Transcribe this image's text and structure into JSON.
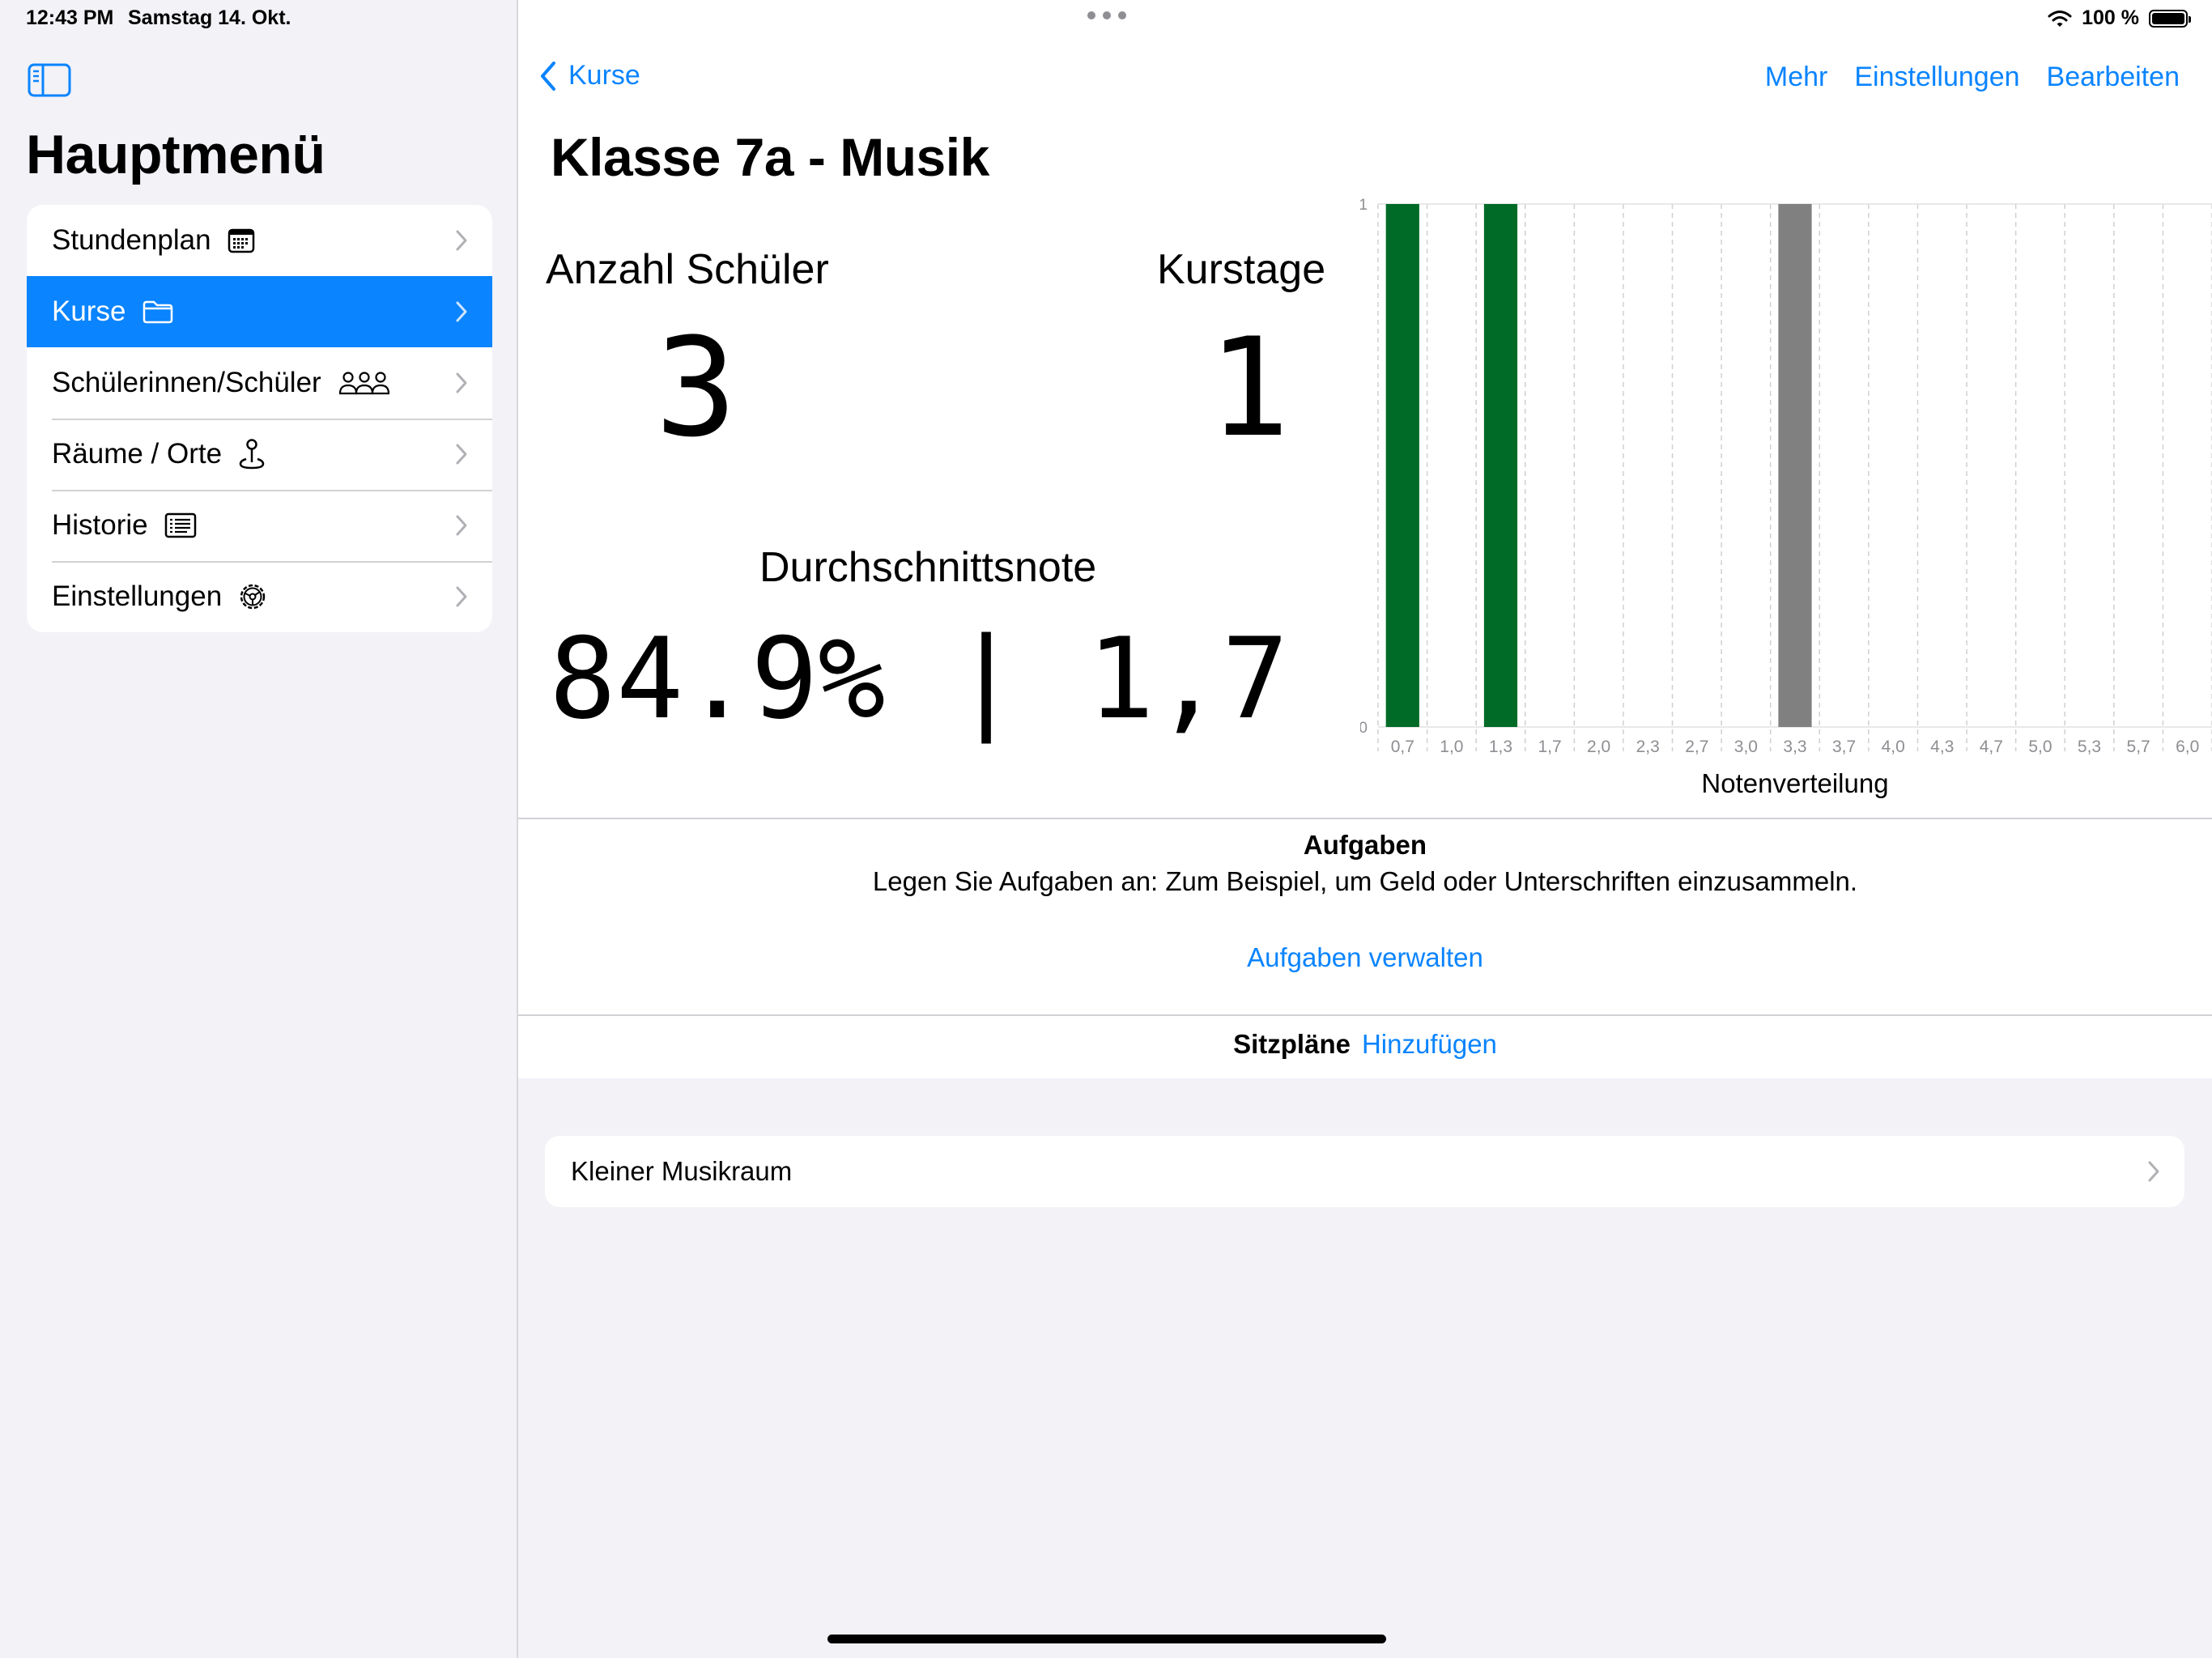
{
  "status": {
    "time": "12:43 PM",
    "date": "Samstag 14. Okt.",
    "battery": "100 %",
    "battery_level": 1.0
  },
  "sidebar": {
    "title": "Hauptmenü",
    "items": [
      {
        "label": "Stundenplan",
        "icon": "calendar-icon",
        "active": false
      },
      {
        "label": "Kurse",
        "icon": "folder-icon",
        "active": true
      },
      {
        "label": "Schülerinnen/Schüler",
        "icon": "people-icon",
        "active": false
      },
      {
        "label": "Räume / Orte",
        "icon": "map-pin-icon",
        "active": false
      },
      {
        "label": "Historie",
        "icon": "list-icon",
        "active": false
      },
      {
        "label": "Einstellungen",
        "icon": "gear-icon",
        "active": false
      }
    ]
  },
  "nav": {
    "back_label": "Kurse",
    "actions": [
      "Mehr",
      "Einstellungen",
      "Bearbeiten"
    ]
  },
  "course": {
    "title": "Klasse 7a - Musik",
    "students_label": "Anzahl Schüler",
    "students_value": "3",
    "days_label": "Kurstage",
    "days_value": "1",
    "average_label": "Durchschnittsnote",
    "average_percent": "84.9%",
    "average_separator": "|",
    "average_grade": "1,7"
  },
  "chart_data": {
    "type": "bar",
    "xlabel": "Notenverteilung",
    "ylabel": "",
    "ylim": [
      0,
      1
    ],
    "y_ticks": [
      "0",
      "1"
    ],
    "categories": [
      "0,7",
      "1,0",
      "1,3",
      "1,7",
      "2,0",
      "2,3",
      "2,7",
      "3,0",
      "3,3",
      "3,7",
      "4,0",
      "4,3",
      "4,7",
      "5,0",
      "5,3",
      "5,7",
      "6,0"
    ],
    "values": [
      1,
      0,
      1,
      0,
      0,
      0,
      0,
      0,
      1,
      0,
      0,
      0,
      0,
      0,
      0,
      0,
      0
    ],
    "bar_colors": [
      "#006b26",
      "#006b26",
      "#006b26",
      "#006b26",
      "#006b26",
      "#006b26",
      "#006b26",
      "#006b26",
      "#808080",
      "#808080",
      "#808080",
      "#808080",
      "#808080",
      "#808080",
      "#808080",
      "#808080",
      "#808080"
    ],
    "grid": true,
    "legend": "none"
  },
  "tasks": {
    "title": "Aufgaben",
    "description": "Legen Sie Aufgaben an: Zum Beispiel, um Geld oder Unterschriften einzusammeln.",
    "link": "Aufgaben verwalten"
  },
  "seating": {
    "title": "Sitzpläne",
    "add_label": "Hinzufügen",
    "rooms": [
      "Kleiner Musikraum"
    ]
  },
  "colors": {
    "accent": "#0a84ff",
    "pass": "#006b26",
    "fail": "#808080"
  }
}
